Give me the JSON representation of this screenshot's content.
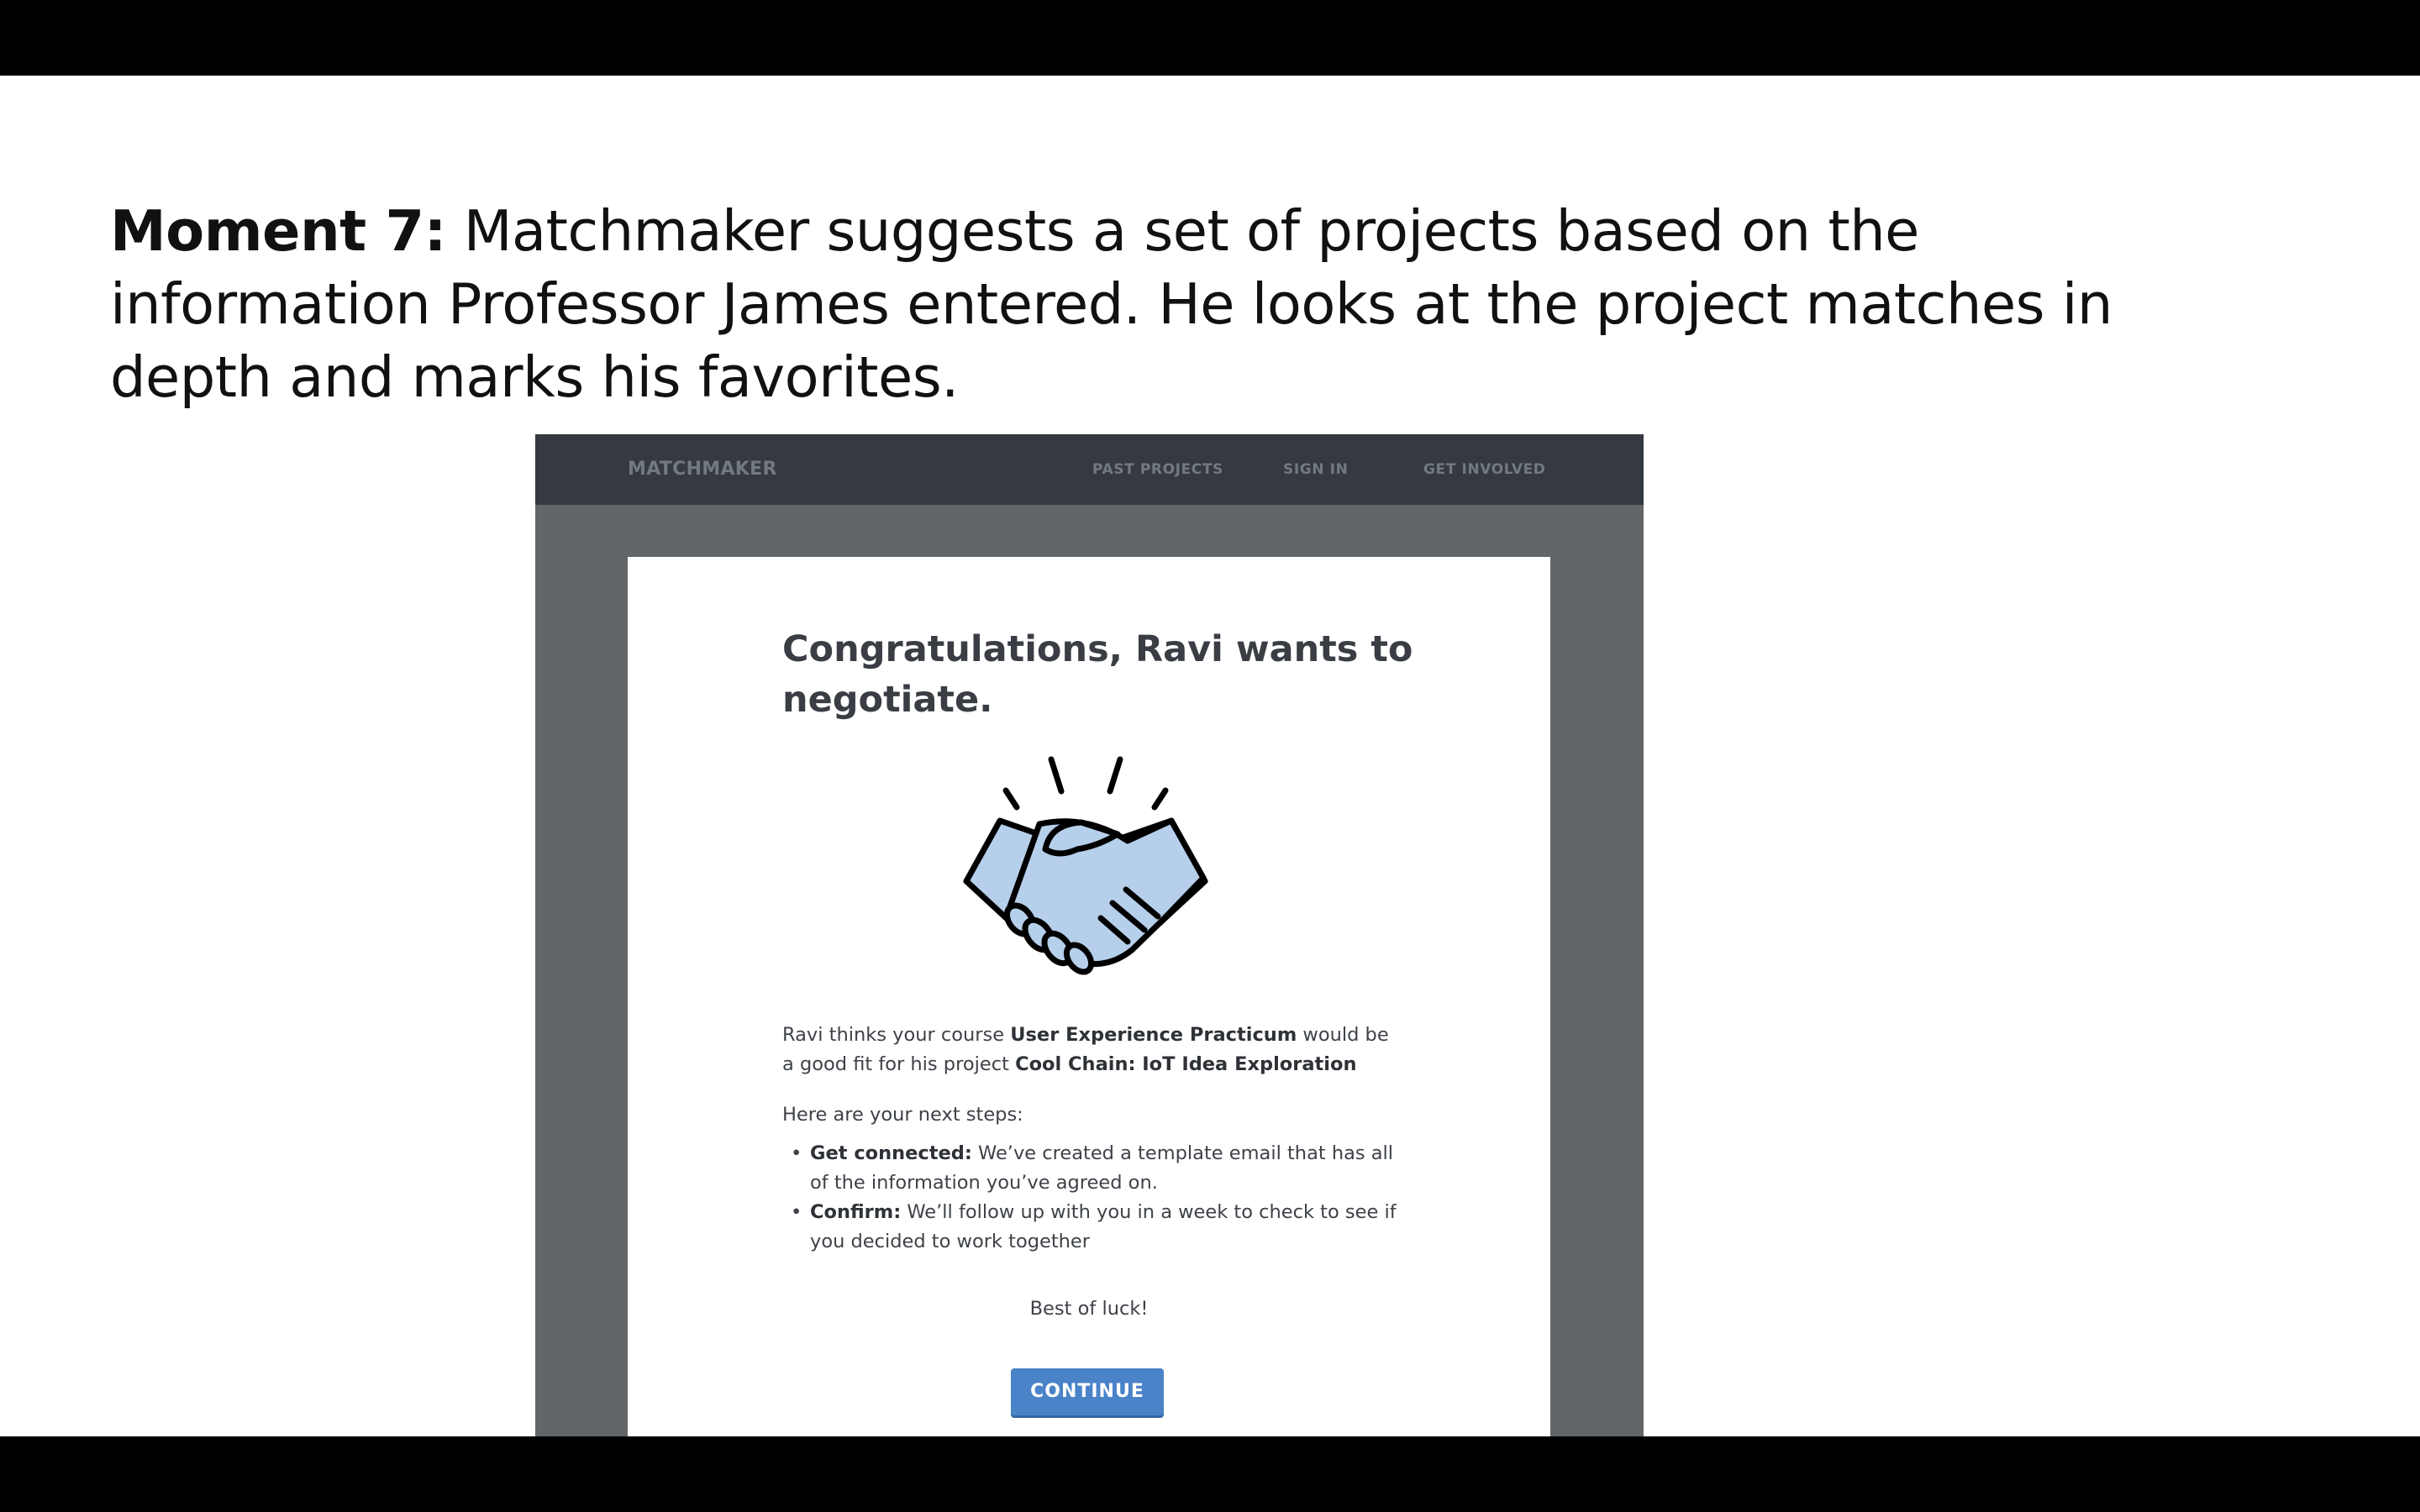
{
  "slide": {
    "caption_lead": "Moment 7:",
    "caption_text": " Matchmaker suggests a set of projects based on the information Professor James entered. He looks at the project matches  in depth and marks his favorites."
  },
  "navbar": {
    "brand": "MATCHMAKER",
    "links": [
      "PAST PROJECTS",
      "SIGN IN",
      "GET INVOLVED"
    ]
  },
  "card": {
    "title": "Congratulations, Ravi wants to negotiate.",
    "icon": "handshake-icon",
    "intro_pre": "Ravi thinks your course ",
    "course_name": "User Experience Practicum",
    "intro_mid": " would be a good fit for his project ",
    "project_name": "Cool Chain: IoT Idea Exploration",
    "steps_heading": "Here are your next steps:",
    "steps": [
      {
        "title": "Get connected:",
        "text": " We’ve created a template email that has all of the information you’ve agreed on."
      },
      {
        "title": "Confirm:",
        "text": " We’ll follow up with you in a week to check to see if you decided to work together"
      }
    ],
    "closing": "Best of luck!",
    "continue_label": "CONTINUE"
  },
  "colors": {
    "navbar": "#353a40",
    "window_background": "#636669",
    "button": "#4a83c8",
    "handshake_fill": "#b6cfeb"
  }
}
